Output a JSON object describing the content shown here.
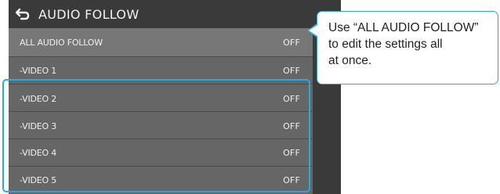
{
  "screen": {
    "title": "AUDIO FOLLOW",
    "back_icon": "return-arrow-icon",
    "rows": [
      {
        "label": "ALL AUDIO FOLLOW",
        "value": "OFF"
      },
      {
        "label": "-VIDEO 1",
        "value": "OFF"
      },
      {
        "label": "-VIDEO 2",
        "value": "OFF"
      },
      {
        "label": "-VIDEO 3",
        "value": "OFF"
      },
      {
        "label": "-VIDEO 4",
        "value": "OFF"
      },
      {
        "label": "-VIDEO 5",
        "value": "OFF"
      }
    ]
  },
  "callout": {
    "line1": "Use “ALL AUDIO FOLLOW”",
    "line2": "to edit the settings all",
    "line3": "at once."
  },
  "colors": {
    "accent": "#2aa9e0",
    "panel": "#666666",
    "title_bar": "#3a3a3a"
  }
}
